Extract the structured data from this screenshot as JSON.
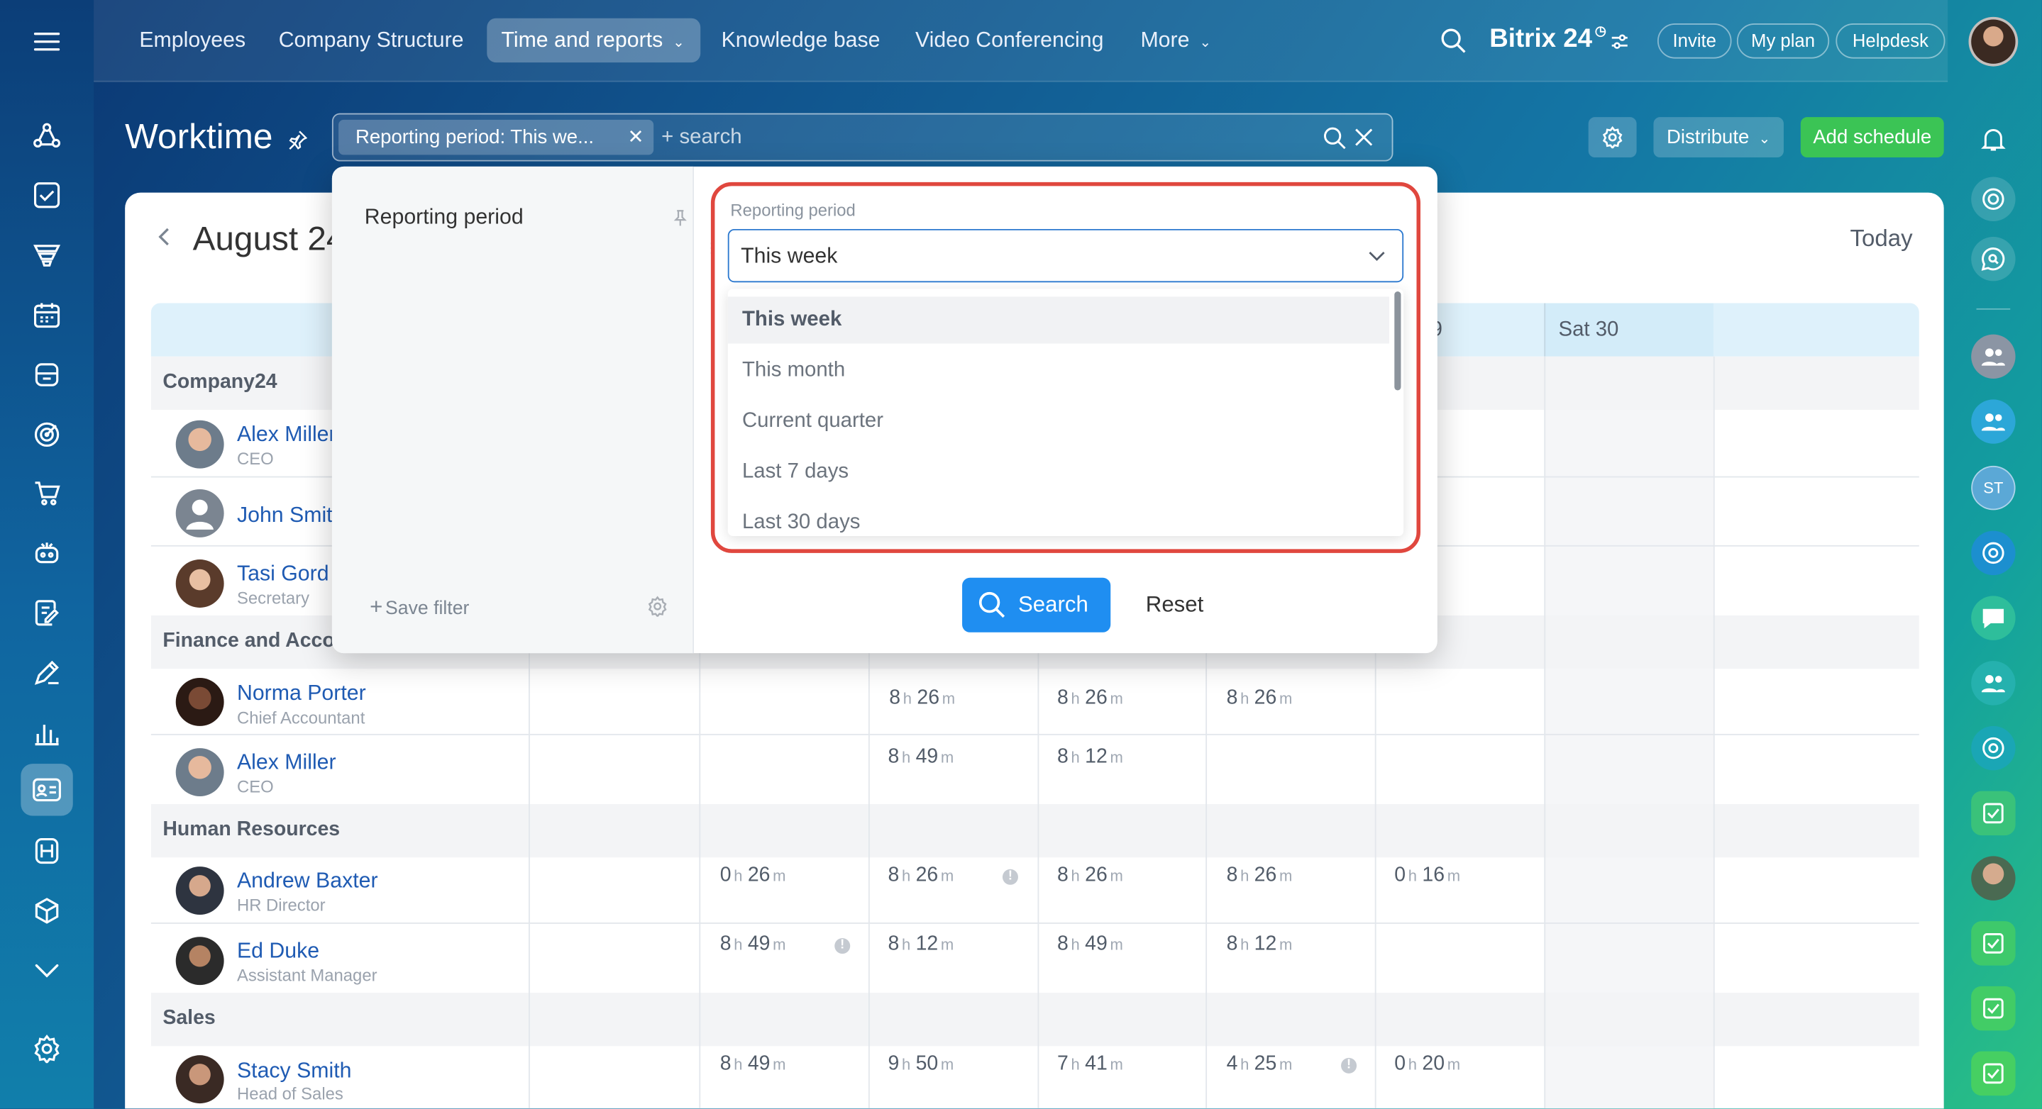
{
  "topnav": {
    "items": [
      {
        "label": "Employees"
      },
      {
        "label": "Company Structure"
      },
      {
        "label": "Time and reports"
      },
      {
        "label": "Knowledge base"
      },
      {
        "label": "Video Conferencing"
      },
      {
        "label": "More"
      }
    ],
    "brand": "Bitrix 24",
    "invite": "Invite",
    "my_plan": "My plan",
    "helpdesk": "Helpdesk"
  },
  "page": {
    "title": "Worktime",
    "filter_chip": "Reporting period: This we...",
    "search_placeholder": "+ search",
    "distribute": "Distribute",
    "add_schedule": "Add schedule"
  },
  "calendar": {
    "month": "August 24",
    "today": "Today",
    "col_fri_partial": "9",
    "col_sat": "Sat 30"
  },
  "groups": [
    {
      "name": "Company24",
      "employees": [
        {
          "name": "Alex Miller",
          "position": "CEO"
        },
        {
          "name": "John Smit",
          "position": ""
        },
        {
          "name": "Tasi Gord",
          "position": "Secretary"
        }
      ]
    },
    {
      "name": "Finance and Acco",
      "employees": [
        {
          "name": "Norma Porter",
          "position": "Chief Accountant",
          "times": [
            "",
            "",
            "8h 26m",
            "8h 26m",
            "8h 26m",
            "",
            ""
          ]
        },
        {
          "name": "Alex Miller",
          "position": "CEO",
          "times": [
            "",
            "",
            "8h 49m",
            "8h 12m",
            "",
            "",
            ""
          ]
        }
      ]
    },
    {
      "name": "Human Resources",
      "employees": [
        {
          "name": "Andrew Baxter",
          "position": "HR Director",
          "times": [
            "",
            "0h 26m",
            "8h 26m",
            "8h 26m",
            "8h 26m",
            "0h 16m",
            ""
          ]
        },
        {
          "name": "Ed Duke",
          "position": "Assistant Manager",
          "times": [
            "",
            "8h 49m",
            "8h 12m",
            "8h 49m",
            "8h 12m",
            "",
            ""
          ]
        }
      ]
    },
    {
      "name": "Sales",
      "employees": [
        {
          "name": "Stacy Smith",
          "position": "Head of Sales",
          "times": [
            "",
            "8h 49m",
            "9h 50m",
            "7h 41m",
            "4h 25m",
            "0h 20m",
            ""
          ]
        }
      ]
    }
  ],
  "filter_popup": {
    "preset_title": "Reporting period",
    "save_filter": "Save filter",
    "field_label": "Reporting period",
    "selected_value": "This week",
    "options": [
      "This week",
      "This month",
      "Current quarter",
      "Last 7 days",
      "Last 30 days"
    ],
    "search_button": "Search",
    "reset_button": "Reset"
  },
  "colors": {
    "accent_blue": "#1f8ef1",
    "add_schedule_green": "#3bc455",
    "highlight_red": "#e0473e",
    "link_blue": "#1f5bb3"
  }
}
